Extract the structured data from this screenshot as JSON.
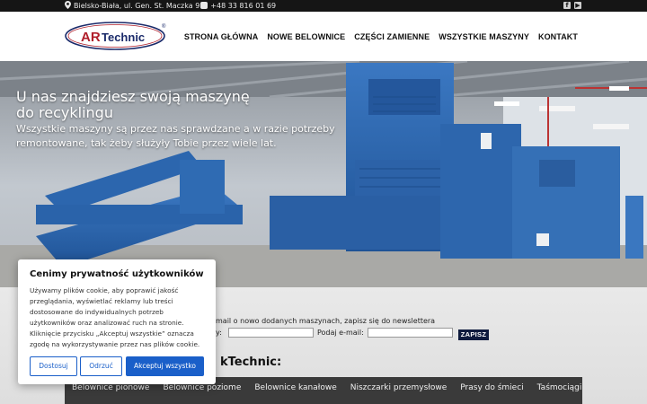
{
  "topbar": {
    "address": "Bielsko-Biała, ul. Gen. St. Maczka 9",
    "phone": "+48 33 816 01 69",
    "social": [
      {
        "icon": "facebook-icon",
        "glyph": "f"
      },
      {
        "icon": "youtube-icon",
        "glyph": "▶"
      }
    ]
  },
  "header": {
    "logo": {
      "text_ar": "AR",
      "text_rest": "Technic",
      "registered": "®"
    },
    "nav": [
      {
        "label": "STRONA GŁÓWNA"
      },
      {
        "label": "NOWE BELOWNICE"
      },
      {
        "label": "CZĘŚCI ZAMIENNE"
      },
      {
        "label": "WSZYSTKIE MASZYNY"
      },
      {
        "label": "KONTAKT"
      }
    ]
  },
  "hero": {
    "title": "U nas znajdziesz swoją maszynę do recyklingu",
    "subtitle": "Wszystkie maszyny są przez nas sprawdzane a w razie potrzeby remontowane, tak żeby służyły Tobie przez wiele lat."
  },
  "newsletter": {
    "text": "mail o nowo dodanych maszynach, zapisz się do newslettera",
    "label_name": "y:",
    "label_email": "Podaj e-mail:",
    "name_value": "",
    "email_value": "",
    "button": "ZAPISZ"
  },
  "section": {
    "title": "kTechnic:"
  },
  "categories": [
    {
      "label": "Belownice pionowe"
    },
    {
      "label": "Belownice poziome"
    },
    {
      "label": "Belownice kanałowe"
    },
    {
      "label": "Niszczarki przemysłowe"
    },
    {
      "label": "Prasy do śmieci"
    },
    {
      "label": "Taśmociągi"
    }
  ],
  "cookie": {
    "title": "Cenimy prywatność użytkowników",
    "body": "Używamy plików cookie, aby poprawić jakość przeglądania, wyświetlać reklamy lub treści dostosowane do indywidualnych potrzeb użytkowników oraz analizować ruch na stronie. Kliknięcie przycisku „Akceptuj wszystkie” oznacza zgodę na wykorzystywanie przez nas plików cookie.",
    "buttons": {
      "customize": "Dostosuj",
      "reject": "Odrzuć",
      "accept": "Akceptuj wszystko"
    }
  },
  "colors": {
    "accent": "#1a5fc9",
    "machine_blue": "#2a64ad",
    "nav_dark": "#151515",
    "logo_red": "#b01e2a"
  }
}
